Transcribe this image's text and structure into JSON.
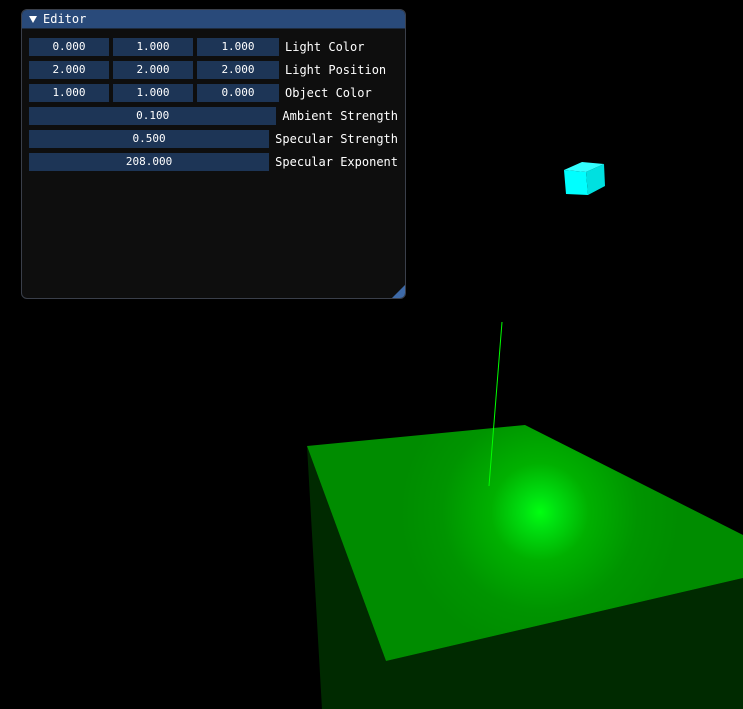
{
  "editor": {
    "title": "Editor",
    "rows": [
      {
        "values": [
          "0.000",
          "1.000",
          "1.000"
        ],
        "label": "Light Color"
      },
      {
        "values": [
          "2.000",
          "2.000",
          "2.000"
        ],
        "label": "Light Position"
      },
      {
        "values": [
          "1.000",
          "1.000",
          "0.000"
        ],
        "label": "Object Color"
      },
      {
        "values": [
          "0.100"
        ],
        "label": "Ambient Strength"
      },
      {
        "values": [
          "0.500"
        ],
        "label": "Specular Strength"
      },
      {
        "values": [
          "208.000"
        ],
        "label": "Specular Exponent"
      }
    ]
  },
  "colors": {
    "background": "#000000",
    "title_bar": "#294a7a",
    "field": "#1d3556",
    "light_cube": "#00ffff",
    "object_top": "#009000",
    "object_side": "#002a00",
    "ray": "#00ff00"
  }
}
